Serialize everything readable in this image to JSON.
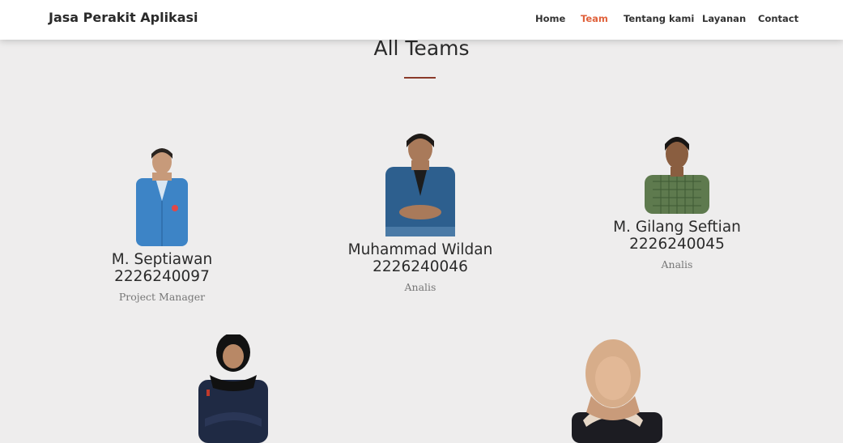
{
  "brand": "Jasa Perakit Aplikasi",
  "nav": {
    "items": [
      {
        "label": "Home",
        "active": false
      },
      {
        "label": "Team",
        "active": true
      },
      {
        "label": "Tentang kami",
        "active": false
      },
      {
        "label": "Layanan",
        "active": false
      },
      {
        "label": "Contact",
        "active": false
      }
    ]
  },
  "colors": {
    "accent": "#e0623c",
    "divider": "#8a3a2a",
    "background": "#eeeded"
  },
  "section": {
    "title": "All Teams"
  },
  "members": [
    {
      "name": "M. Septiawan",
      "nim": "2226240097",
      "role": "Project Manager"
    },
    {
      "name": "Muhammad Wildan",
      "nim": "2226240046",
      "role": "Analis"
    },
    {
      "name": "M. Gilang Seftian",
      "nim": "2226240045",
      "role": "Analis"
    },
    {
      "name": "",
      "nim": "",
      "role": ""
    },
    {
      "name": "",
      "nim": "",
      "role": ""
    }
  ]
}
